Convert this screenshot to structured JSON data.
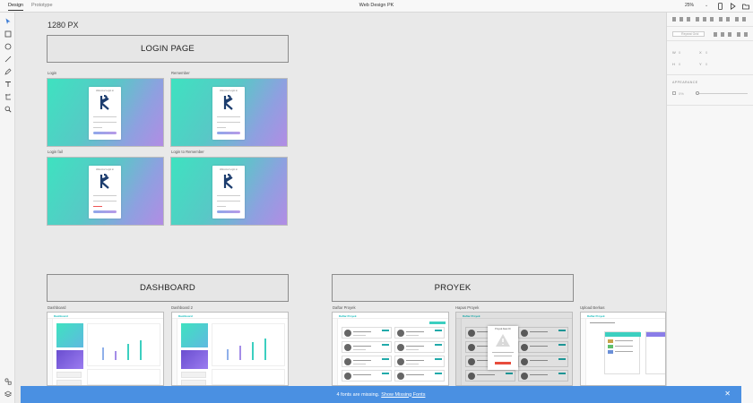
{
  "topbar": {
    "tabs": [
      {
        "label": "Design"
      },
      {
        "label": "Prototype"
      }
    ],
    "document_title": "Web Design PK",
    "zoom": "25%",
    "icons": [
      "caret-down-icon",
      "mobile-preview-icon",
      "play-icon",
      "share-icon"
    ]
  },
  "left_toolbar": {
    "tools": [
      "select-icon",
      "rectangle-icon",
      "ellipse-icon",
      "line-icon",
      "pen-icon",
      "text-icon",
      "artboard-icon",
      "zoom-icon"
    ],
    "bottom_tools": [
      "assets-icon",
      "layers-icon"
    ]
  },
  "right_panel": {
    "component_label": "Repeat Grid",
    "w_label": "W",
    "w_value": "0",
    "x_label": "X",
    "x_value": "0",
    "h_label": "H",
    "h_value": "0",
    "y_label": "Y",
    "y_value": "0",
    "appearance_heading": "APPEARANCE",
    "opacity_value": "0%"
  },
  "canvas": {
    "size_label": "1280 PX",
    "sections": {
      "login": "LOGIN PAGE",
      "dashboard": "DASHBOARD",
      "proyek": "PROYEK"
    },
    "artboards": {
      "login": "Login",
      "remember": "Remember",
      "login_fail": "Login fail",
      "login_to_remember": "Login to Remember",
      "dashboard": "Dashboard",
      "dashboard2": "Dashboard 2",
      "daftar_proyek": "Daftar Proyek",
      "hapus_proyek": "Hapus Proyek",
      "upload_berkas": "Upload Berkas"
    },
    "login_card_title": "Welcome! Login to",
    "app_brand": "Daftar Proyek",
    "dashboard_brand": "Dashboard",
    "modal_title": "Proyek Akan Di"
  },
  "banner": {
    "message": "4 fonts are missing.",
    "link": "Show Missing Fonts",
    "color": "#4a90e2"
  }
}
